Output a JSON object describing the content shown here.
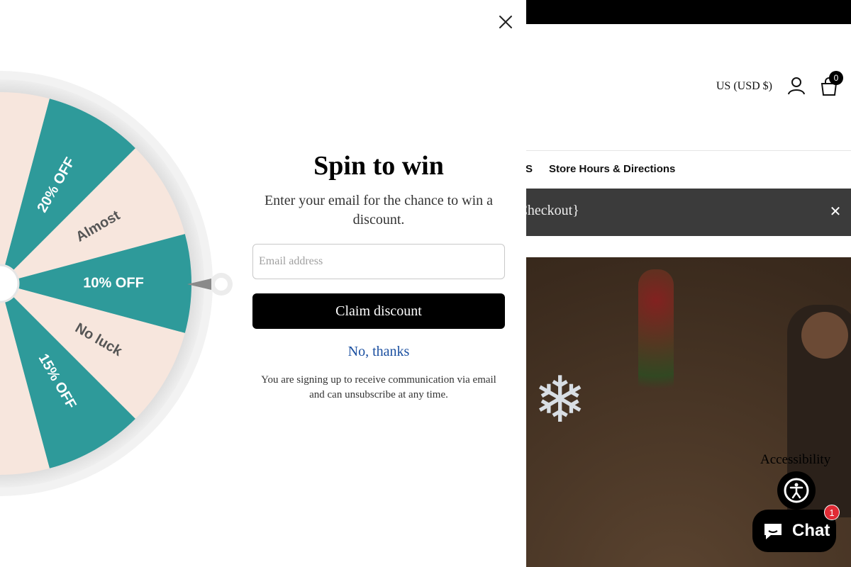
{
  "background": {
    "header": {
      "currency": "US (USD $)",
      "cart_count": "0",
      "icons": [
        "account-icon",
        "cart-icon"
      ]
    },
    "nav": {
      "items": [
        "S",
        "Store Hours & Directions"
      ]
    },
    "announcement": {
      "text": "um Checkout}",
      "close_icon": "close-icon"
    }
  },
  "popup": {
    "title": "Spin to win",
    "subtitle": "Enter your email for the chance to win a discount.",
    "email": {
      "placeholder": "Email address",
      "value": ""
    },
    "claim_label": "Claim discount",
    "decline_label": "No, thanks",
    "disclaimer": "You are signing up to receive communication via email and can unsubscribe at any time.",
    "close_icon": "close-icon"
  },
  "wheel": {
    "segments": [
      {
        "label": "20% OFF",
        "color": "#2e9a9a",
        "text_color": "#ffffff"
      },
      {
        "label": "Almost",
        "color": "#f7e6dd",
        "text_color": "#555555"
      },
      {
        "label": "10% OFF",
        "color": "#2e9a9a",
        "text_color": "#ffffff"
      },
      {
        "label": "No luck",
        "color": "#f7e6dd",
        "text_color": "#555555"
      },
      {
        "label": "15% OFF",
        "color": "#2e9a9a",
        "text_color": "#ffffff"
      }
    ],
    "rim_color": "#d9d9d9"
  },
  "widgets": {
    "accessibility_label": "Accessibility",
    "chat_label": "Chat",
    "chat_badge": "1"
  },
  "colors": {
    "accent": "#2e9a9a",
    "button": "#000000",
    "link": "#1a4fa0",
    "badge": "#e02b35"
  }
}
